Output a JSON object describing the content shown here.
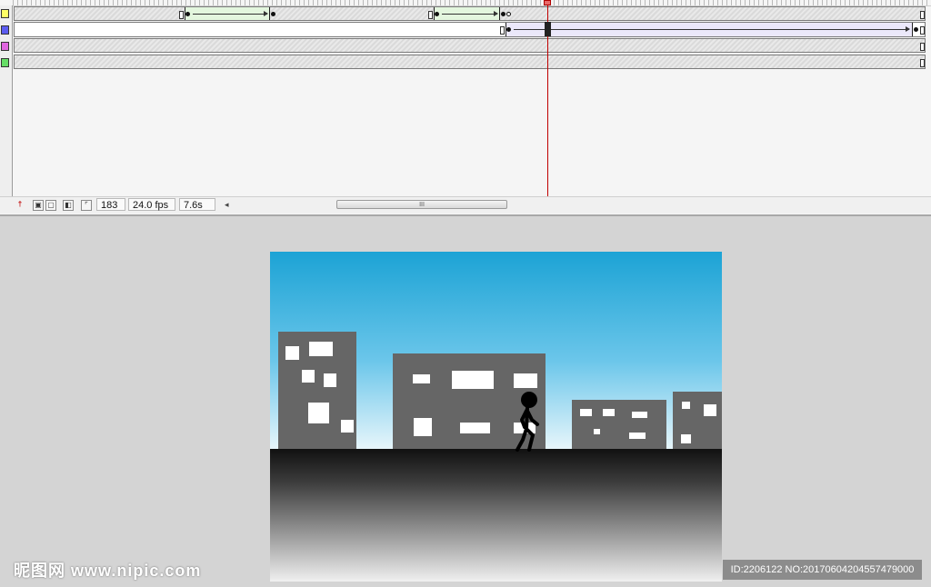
{
  "timeline": {
    "layer_colors": [
      "#ffff66",
      "#5b5bf0",
      "#e066e0",
      "#66dd66"
    ],
    "playhead_color": "#c00000"
  },
  "status_bar": {
    "center_frame_icon": "onion-skin-icon",
    "current_frame": "183",
    "frame_rate": "24.0 fps",
    "elapsed_time": "7.6s",
    "scroll_left": "◂",
    "scroll_thumb_grip": "III"
  },
  "stage": {
    "sky_color": "#1ca3d5",
    "building_color": "#666666",
    "ground_color": "#111111"
  },
  "watermark": {
    "logo_text": "昵图网 www.nipic.com",
    "id_text": "ID:2206122 NO:20170604204557479000"
  }
}
